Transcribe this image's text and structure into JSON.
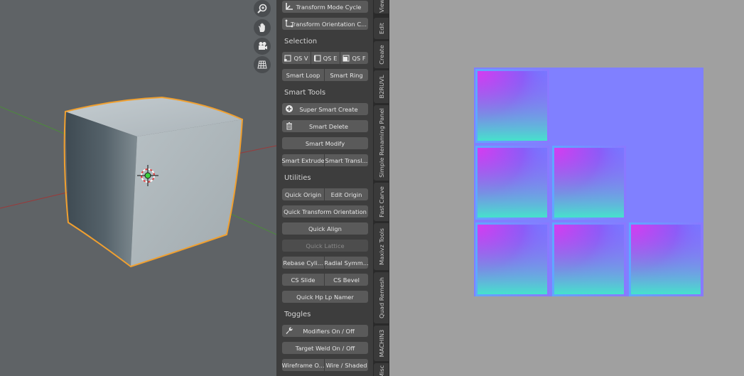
{
  "panel": {
    "rows": [
      {
        "kind": "button",
        "label": "Transform Mode Cycle",
        "icon": "transform-axis-icon"
      },
      {
        "kind": "button",
        "label": "Transform Orientation C...",
        "icon": "orientation-icon"
      },
      {
        "kind": "header",
        "label": "Selection"
      },
      {
        "kind": "triple",
        "labels": [
          "QS V",
          "QS E",
          "QS F"
        ],
        "icons": [
          "vertex-select-icon",
          "edge-select-icon",
          "face-select-icon"
        ]
      },
      {
        "kind": "pair",
        "labels": [
          "Smart Loop",
          "Smart Ring"
        ]
      },
      {
        "kind": "header",
        "label": "Smart Tools"
      },
      {
        "kind": "button",
        "label": "Super Smart Create",
        "icon": "add-circle-icon"
      },
      {
        "kind": "button",
        "label": "Smart Delete",
        "icon": "trash-icon"
      },
      {
        "kind": "button",
        "label": "Smart Modify"
      },
      {
        "kind": "pair",
        "labels": [
          "Smart Extrude",
          "Smart Transl..."
        ]
      },
      {
        "kind": "header",
        "label": "Utilities"
      },
      {
        "kind": "pair",
        "labels": [
          "Quick Origin",
          "Edit Origin"
        ]
      },
      {
        "kind": "button",
        "label": "Quick Transform Orientation"
      },
      {
        "kind": "button",
        "label": "Quick Align"
      },
      {
        "kind": "button",
        "label": "Quick Lattice",
        "disabled": true
      },
      {
        "kind": "pair",
        "labels": [
          "Rebase Cyli...",
          "Radial Symm..."
        ]
      },
      {
        "kind": "pair",
        "labels": [
          "CS Slide",
          "CS Bevel"
        ]
      },
      {
        "kind": "button",
        "label": "Quick Hp Lp Namer"
      },
      {
        "kind": "header",
        "label": "Toggles"
      },
      {
        "kind": "button",
        "label": "Modifiers On / Off",
        "icon": "wrench-icon"
      },
      {
        "kind": "button",
        "label": "Target Weld On / Off"
      },
      {
        "kind": "pair",
        "labels": [
          "Wireframe O...",
          "Wire / Shaded"
        ]
      }
    ]
  },
  "tabs": [
    {
      "label": "View",
      "slug": "view"
    },
    {
      "label": "Edit",
      "slug": "edit"
    },
    {
      "label": "Create",
      "slug": "create"
    },
    {
      "label": "B2RUVL",
      "slug": "b2ruvl"
    },
    {
      "label": "Simple Renaming Panel",
      "slug": "simple-renaming-panel"
    },
    {
      "label": "Fast Carve",
      "slug": "fast-carve"
    },
    {
      "label": "Maxivz Tools",
      "slug": "maxivz-tools"
    },
    {
      "label": "Quad Remesh",
      "slug": "quad-remesh"
    },
    {
      "label": "MACHIN3",
      "slug": "machin3"
    },
    {
      "label": "Misc",
      "slug": "misc"
    }
  ],
  "viewport_nav": [
    "zoom-icon",
    "pan-hand-icon",
    "camera-icon",
    "grid-icon"
  ],
  "colors": {
    "viewport_bg": "#5f6366",
    "panel_bg": "#3d3d3d",
    "button": "#5a5a5a",
    "selection_outline": "#f0a030",
    "uv_bg": "#8080ff",
    "normal_magenta": "#c040f0",
    "normal_cyan": "#40e0d0"
  }
}
